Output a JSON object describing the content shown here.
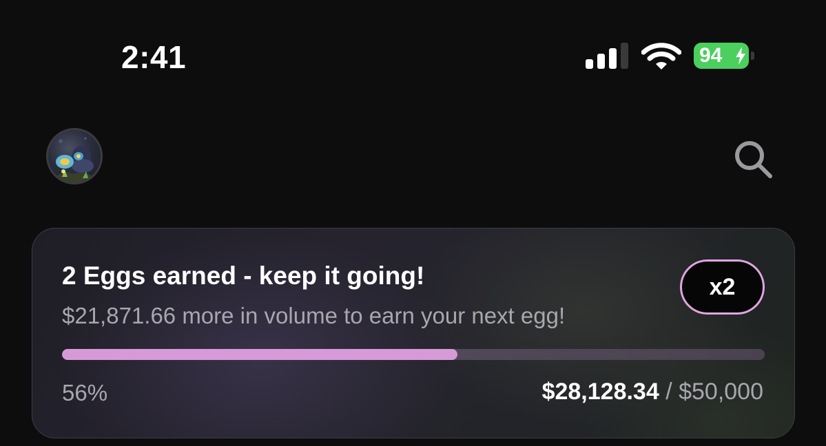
{
  "status_bar": {
    "time": "2:41",
    "battery_percent": "94",
    "signal_bars_active": 3,
    "signal_bars_total": 4,
    "battery_color": "#4bcf5d"
  },
  "header": {
    "avatar_icon": "egg-avatar",
    "search_icon": "search-icon"
  },
  "card": {
    "title": "2 Eggs earned - keep it going!",
    "subtitle": "$21,871.66 more in volume to earn your next egg!",
    "multiplier": "x2",
    "progress_fraction": 0.5626,
    "progress_label": "56%",
    "current_amount": "$28,128.34",
    "separator": " / ",
    "goal_amount": "$50,000",
    "accent_color": "#d79ad8"
  }
}
